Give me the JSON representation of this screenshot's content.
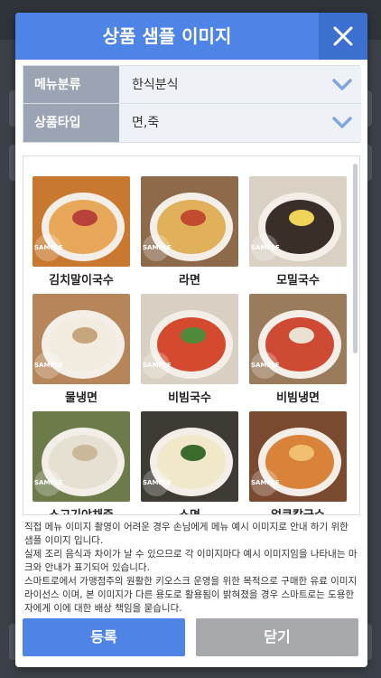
{
  "modal": {
    "title": "상품 샘플 이미지",
    "close_icon": "close-icon"
  },
  "form": {
    "menu_category": {
      "label": "메뉴분류",
      "value": "한식분식"
    },
    "product_type": {
      "label": "상품타입",
      "value": "면,죽"
    }
  },
  "samples": [
    {
      "name": "김치말이국수",
      "badge": "SAMPLE",
      "colors": [
        "#c9792f",
        "#e8a85a",
        "#b8423a"
      ]
    },
    {
      "name": "라면",
      "badge": "SAMPLE",
      "colors": [
        "#8d6a4a",
        "#e0b15a",
        "#c24a2e"
      ]
    },
    {
      "name": "모밀국수",
      "badge": "SAMPLE",
      "colors": [
        "#d9d2c4",
        "#3a2e28",
        "#f0d45a"
      ]
    },
    {
      "name": "물냉면",
      "badge": "SAMPLE",
      "colors": [
        "#b6865a",
        "#f2ece0",
        "#c6a57c"
      ]
    },
    {
      "name": "비빔국수",
      "badge": "SAMPLE",
      "colors": [
        "#d8d0c2",
        "#d44a2e",
        "#4f8a3a"
      ]
    },
    {
      "name": "비빔냉면",
      "badge": "SAMPLE",
      "colors": [
        "#9a7b5c",
        "#cf4a32",
        "#e9e1d2"
      ]
    },
    {
      "name": "소고기야채죽",
      "badge": "SAMPLE",
      "colors": [
        "#6d7a4a",
        "#e6e0d2",
        "#c9b99a"
      ]
    },
    {
      "name": "소면",
      "badge": "SAMPLE",
      "colors": [
        "#3e3a34",
        "#f1e7c9",
        "#3c6b2e"
      ]
    },
    {
      "name": "얼큰칼국수",
      "badge": "SAMPLE",
      "colors": [
        "#7a4a30",
        "#d9823a",
        "#f0c070"
      ]
    }
  ],
  "notice": [
    "직접 메뉴 이미지 촬영이 어려운 경우 손님에게 메뉴 예시 이미지로 안내 하기 위한 샘플 이미지 입니다.",
    "실제 조리 음식과 차이가 날 수 있으므로 각 이미지마다 예시 이미지임을 나타내는 마크와 안내가 표기되어 있습니다.",
    "스마트로에서 가맹점주의 원활한 키오스크 운영을 위한 목적으로 구매한 유료 이미지 라이선스 이며, 본 이미지가 다른 용도로 활용됨이 밝혀졌을 경우 스마트로는 도용한 자에게 이에 대한 배상 책임을 묻습니다."
  ],
  "buttons": {
    "register": "등록",
    "close": "닫기"
  },
  "colors": {
    "accent": "#4d84e6",
    "secondary": "#a7a9ad",
    "label_bg": "#9aa4b3"
  }
}
